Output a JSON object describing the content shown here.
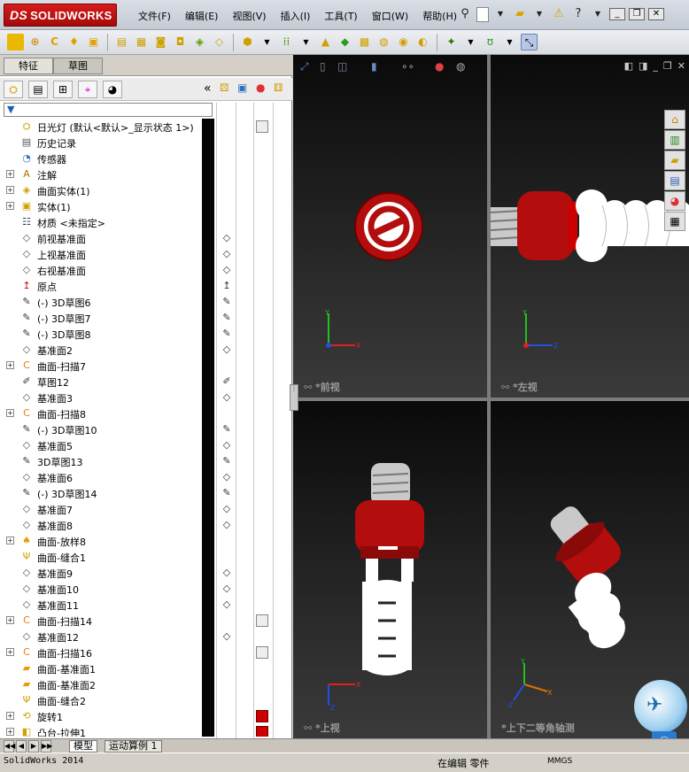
{
  "app": {
    "logo_text": "SOLIDWORKS",
    "logo_prefix": "DS"
  },
  "menu": [
    "文件(F)",
    "编辑(E)",
    "视图(V)",
    "插入(I)",
    "工具(T)",
    "窗口(W)",
    "帮助(H)"
  ],
  "left_panel": {
    "tabs": [
      "特征",
      "草图"
    ],
    "active_tab": "草图",
    "collapse_symbol": "«",
    "filter_icon": "filter-icon"
  },
  "tree": [
    {
      "label": "日光灯  (默认<默认>_显示状态 1>)",
      "icon": "part-icon",
      "expand": false,
      "col2": "",
      "col3": "plain"
    },
    {
      "label": "历史记录",
      "icon": "history-icon",
      "expand": false,
      "col2": "",
      "col3": ""
    },
    {
      "label": "传感器",
      "icon": "sensor-icon",
      "expand": false,
      "col2": "",
      "col3": ""
    },
    {
      "label": "注解",
      "icon": "annotation-icon",
      "expand": true,
      "col2": "",
      "col3": ""
    },
    {
      "label": "曲面实体(1)",
      "icon": "surface-body-icon",
      "expand": true,
      "col2": "",
      "col3": ""
    },
    {
      "label": "实体(1)",
      "icon": "solid-body-icon",
      "expand": true,
      "col2": "",
      "col3": ""
    },
    {
      "label": "材质 <未指定>",
      "icon": "material-icon",
      "expand": false,
      "col2": "",
      "col3": ""
    },
    {
      "label": "前视基准面",
      "icon": "plane-icon",
      "expand": false,
      "col2": "plane",
      "col3": ""
    },
    {
      "label": "上视基准面",
      "icon": "plane-icon",
      "expand": false,
      "col2": "plane",
      "col3": ""
    },
    {
      "label": "右视基准面",
      "icon": "plane-icon",
      "expand": false,
      "col2": "plane",
      "col3": ""
    },
    {
      "label": "原点",
      "icon": "origin-icon",
      "expand": false,
      "col2": "origin",
      "col3": ""
    },
    {
      "label": "(-) 3D草图6",
      "icon": "sketch3d-icon",
      "expand": false,
      "col2": "sketch3d",
      "col3": ""
    },
    {
      "label": "(-) 3D草图7",
      "icon": "sketch3d-icon",
      "expand": false,
      "col2": "sketch3d",
      "col3": ""
    },
    {
      "label": "(-) 3D草图8",
      "icon": "sketch3d-icon",
      "expand": false,
      "col2": "sketch3d",
      "col3": ""
    },
    {
      "label": "基准面2",
      "icon": "plane-icon",
      "expand": false,
      "col2": "plane",
      "col3": ""
    },
    {
      "label": "曲面-扫描7",
      "icon": "sweep-icon",
      "expand": true,
      "col2": "",
      "col3": ""
    },
    {
      "label": "草图12",
      "icon": "sketch-icon",
      "expand": false,
      "col2": "sketch",
      "col3": ""
    },
    {
      "label": "基准面3",
      "icon": "plane-icon",
      "expand": false,
      "col2": "plane",
      "col3": ""
    },
    {
      "label": "曲面-扫描8",
      "icon": "sweep-icon",
      "expand": true,
      "col2": "",
      "col3": ""
    },
    {
      "label": "(-) 3D草图10",
      "icon": "sketch3d-icon",
      "expand": false,
      "col2": "sketch3d",
      "col3": ""
    },
    {
      "label": "基准面5",
      "icon": "plane-icon",
      "expand": false,
      "col2": "plane",
      "col3": ""
    },
    {
      "label": "3D草图13",
      "icon": "sketch3d-icon",
      "expand": false,
      "col2": "sketch3d",
      "col3": ""
    },
    {
      "label": "基准面6",
      "icon": "plane-icon",
      "expand": false,
      "col2": "plane",
      "col3": ""
    },
    {
      "label": "(-) 3D草图14",
      "icon": "sketch3d-icon",
      "expand": false,
      "col2": "sketch3d",
      "col3": ""
    },
    {
      "label": "基准面7",
      "icon": "plane-icon",
      "expand": false,
      "col2": "plane",
      "col3": ""
    },
    {
      "label": "基准面8",
      "icon": "plane-icon",
      "expand": false,
      "col2": "plane",
      "col3": ""
    },
    {
      "label": "曲面-放样8",
      "icon": "loft-icon",
      "expand": true,
      "col2": "",
      "col3": ""
    },
    {
      "label": "曲面-缝合1",
      "icon": "knit-icon",
      "expand": false,
      "col2": "",
      "col3": ""
    },
    {
      "label": "基准面9",
      "icon": "plane-icon",
      "expand": false,
      "col2": "plane",
      "col3": ""
    },
    {
      "label": "基准面10",
      "icon": "plane-icon",
      "expand": false,
      "col2": "plane",
      "col3": ""
    },
    {
      "label": "基准面11",
      "icon": "plane-icon",
      "expand": false,
      "col2": "plane",
      "col3": ""
    },
    {
      "label": "曲面-扫描14",
      "icon": "sweep-icon",
      "expand": true,
      "col2": "",
      "col3": "plain"
    },
    {
      "label": "基准面12",
      "icon": "plane-icon",
      "expand": false,
      "col2": "plane",
      "col3": ""
    },
    {
      "label": "曲面-扫描16",
      "icon": "sweep-icon",
      "expand": true,
      "col2": "",
      "col3": "plain"
    },
    {
      "label": "曲面-基准面1",
      "icon": "planar-surface-icon",
      "expand": false,
      "col2": "",
      "col3": ""
    },
    {
      "label": "曲面-基准面2",
      "icon": "planar-surface-icon",
      "expand": false,
      "col2": "",
      "col3": ""
    },
    {
      "label": "曲面-缝合2",
      "icon": "knit-icon",
      "expand": false,
      "col2": "",
      "col3": ""
    },
    {
      "label": "旋转1",
      "icon": "revolve-icon",
      "expand": true,
      "col2": "",
      "col3": "red"
    },
    {
      "label": "凸台-拉伸1",
      "icon": "extrude-icon",
      "expand": true,
      "col2": "",
      "col3": "red"
    }
  ],
  "viewports": {
    "front": "*前视",
    "left": "*左视",
    "top": "*上视",
    "iso": "*上下二等角轴测"
  },
  "bottom_tabs": [
    "模型",
    "运动算例 1"
  ],
  "status": {
    "version": "SolidWorks 2014",
    "editing": "在编辑 零件",
    "units": "MMGS"
  },
  "colors": {
    "bulb_red": "#b30d0d",
    "glass_white": "#ffffff",
    "axis_x": "#e02020",
    "axis_y": "#20c020",
    "axis_z": "#2050e0"
  }
}
